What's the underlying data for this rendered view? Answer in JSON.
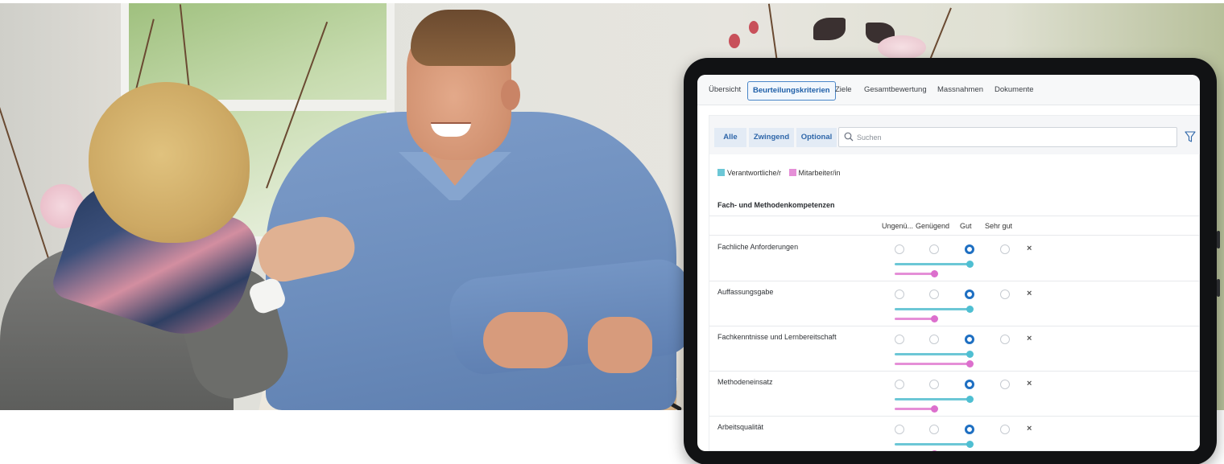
{
  "tabs": [
    {
      "label": "Übersicht",
      "active": false
    },
    {
      "label": "Beurteilungskriterien",
      "active": true
    },
    {
      "label": "Ziele",
      "active": false
    },
    {
      "label": "Gesamtbewertung",
      "active": false
    },
    {
      "label": "Massnahmen",
      "active": false
    },
    {
      "label": "Dokumente",
      "active": false
    }
  ],
  "filters": {
    "all": "Alle",
    "mandatory": "Zwingend",
    "optional": "Optional"
  },
  "search": {
    "placeholder": "Suchen",
    "value": ""
  },
  "legend": {
    "supervisor": "Verantwortliche/r",
    "employee": "Mitarbeiter/in",
    "supervisor_color": "#6cc7d6",
    "employee_color": "#e58fd7"
  },
  "section": {
    "title": "Fach- und Methodenkompetenzen",
    "columns": [
      "Ungenü...",
      "Genügend",
      "Gut",
      "Sehr gut"
    ],
    "criteria": [
      {
        "label": "Fachliche Anforderungen",
        "selected": "Gut",
        "supervisor": "Gut",
        "employee": "Genügend"
      },
      {
        "label": "Auffassungsgabe",
        "selected": "Gut",
        "supervisor": "Gut",
        "employee": "Genügend"
      },
      {
        "label": "Fachkenntnisse und Lernbereitschaft",
        "selected": "Gut",
        "supervisor": "Gut",
        "employee": "Gut"
      },
      {
        "label": "Methodeneinsatz",
        "selected": "Gut",
        "supervisor": "Gut",
        "employee": "Genügend"
      },
      {
        "label": "Arbeitsqualität",
        "selected": "Gut",
        "supervisor": "Gut",
        "employee": "Genügend"
      }
    ]
  },
  "icons": {
    "clear": "×",
    "search": "search-icon",
    "filter": "filter-icon"
  }
}
